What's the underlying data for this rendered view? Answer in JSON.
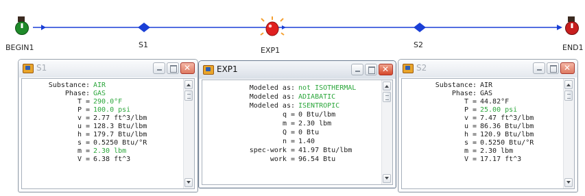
{
  "nodes": {
    "begin": "BEGIN1",
    "s1": "S1",
    "exp": "EXP1",
    "s2": "S2",
    "end": "END1"
  },
  "windows": {
    "s1": {
      "title": "S1",
      "rows": [
        {
          "label": "Substance:",
          "value": "AIR",
          "green": true
        },
        {
          "label": "Phase:",
          "value": "GAS",
          "green": true
        },
        {
          "label": "T =",
          "value": "290.0°F",
          "green": true
        },
        {
          "label": "P =",
          "value": "100.0 psi",
          "green": true
        },
        {
          "label": "v =",
          "value": "2.77 ft^3/lbm",
          "green": false
        },
        {
          "label": "u =",
          "value": "128.3 Btu/lbm",
          "green": false
        },
        {
          "label": "h =",
          "value": "179.7 Btu/lbm",
          "green": false
        },
        {
          "label": "s =",
          "value": "0.5250 Btu/°R",
          "green": false
        },
        {
          "label": "m =",
          "value": "2.30 lbm",
          "green": true
        },
        {
          "label": "V =",
          "value": "6.38 ft^3",
          "green": false
        }
      ]
    },
    "exp": {
      "title": "EXP1",
      "rows": [
        {
          "label": "Modeled as:",
          "value": "not ISOTHERMAL",
          "green": true
        },
        {
          "label": "Modeled as:",
          "value": "ADIABATIC",
          "green": true
        },
        {
          "label": "Modeled as:",
          "value": "ISENTROPIC",
          "green": true
        },
        {
          "label": "q =",
          "value": "0 Btu/lbm",
          "green": false
        },
        {
          "label": "m =",
          "value": "2.30 lbm",
          "green": false
        },
        {
          "label": "Q =",
          "value": "0 Btu",
          "green": false
        },
        {
          "label": "n =",
          "value": "1.40",
          "green": false
        },
        {
          "label": "spec-work =",
          "value": "41.97 Btu/lbm",
          "green": false
        },
        {
          "label": "work =",
          "value": "96.54 Btu",
          "green": false
        }
      ]
    },
    "s2": {
      "title": "S2",
      "rows": [
        {
          "label": "Substance:",
          "value": "AIR",
          "green": false
        },
        {
          "label": "Phase:",
          "value": "GAS",
          "green": false
        },
        {
          "label": "T =",
          "value": "44.82°F",
          "green": false
        },
        {
          "label": "P =",
          "value": "25.00 psi",
          "green": true
        },
        {
          "label": "v =",
          "value": "7.47 ft^3/lbm",
          "green": false
        },
        {
          "label": "u =",
          "value": "86.36 Btu/lbm",
          "green": false
        },
        {
          "label": "h =",
          "value": "120.9 Btu/lbm",
          "green": false
        },
        {
          "label": "s =",
          "value": "0.5250 Btu/°R",
          "green": false
        },
        {
          "label": "m =",
          "value": "2.30 lbm",
          "green": false
        },
        {
          "label": "V =",
          "value": "17.17 ft^3",
          "green": false
        }
      ]
    }
  },
  "colors": {
    "link": "#1a3fd6",
    "green_value": "#2aa63a",
    "begin_node": "#1f8a2a",
    "end_node": "#c81e1e",
    "exp_node": "#e02020"
  }
}
